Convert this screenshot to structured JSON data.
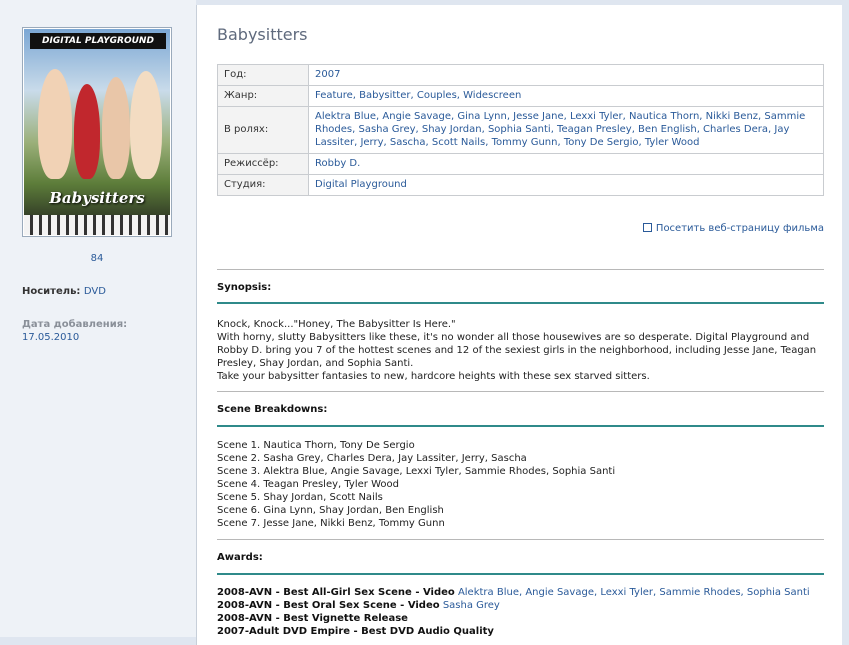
{
  "sidebar": {
    "cover_banner": "DIGITAL PLAYGROUND",
    "cover_title": "Babysitters",
    "cover_number": "84",
    "media_label": "Носитель:",
    "media_value": "DVD",
    "added_label": "Дата добавления:",
    "added_date": "17.05.2010"
  },
  "movie": {
    "title": "Babysitters",
    "info": [
      {
        "key": "Год:",
        "value": "2007"
      },
      {
        "key": "Жанр:",
        "value": "Feature, Babysitter, Couples, Widescreen"
      },
      {
        "key": "В ролях:",
        "value": "Alektra Blue, Angie Savage, Gina Lynn, Jesse Jane, Lexxi Tyler, Nautica Thorn, Nikki Benz, Sammie Rhodes, Sasha Grey, Shay Jordan, Sophia Santi, Teagan Presley, Ben English, Charles Dera, Jay Lassiter, Jerry, Sascha, Scott Nails, Tommy Gunn, Tony De Sergio, Tyler Wood"
      },
      {
        "key": "Режиссёр:",
        "value": "Robby D."
      },
      {
        "key": "Студия:",
        "value": "Digital Playground"
      }
    ],
    "web_link": "Посетить веб-страницу фильма"
  },
  "synopsis": {
    "heading": "Synopsis:",
    "text": "Knock, Knock...\"Honey, The Babysitter Is Here.\"\nWith horny, slutty Babysitters like these, it's no wonder all those housewives are so desperate. Digital Playground and Robby D. bring you 7 of the hottest scenes and 12 of the sexiest girls in the neighborhood, including Jesse Jane, Teagan Presley, Shay Jordan, and Sophia Santi.\nTake your babysitter fantasies to new, hardcore heights with these sex starved sitters."
  },
  "scenes": {
    "heading": "Scene Breakdowns:",
    "text": "Scene 1. Nautica Thorn, Tony De Sergio\nScene 2. Sasha Grey, Charles Dera, Jay Lassiter, Jerry, Sascha\nScene 3. Alektra Blue, Angie Savage, Lexxi Tyler, Sammie Rhodes, Sophia Santi\nScene 4. Teagan Presley, Tyler Wood\nScene 5. Shay Jordan, Scott Nails\nScene 6. Gina Lynn, Shay Jordan, Ben English\nScene 7. Jesse Jane, Nikki Benz, Tommy Gunn"
  },
  "awards": {
    "heading": "Awards:",
    "items": [
      {
        "title": "2008-AVN - Best All-Girl Sex Scene - Video",
        "names": "Alektra Blue, Angie Savage, Lexxi Tyler, Sammie Rhodes, Sophia Santi"
      },
      {
        "title": "2008-AVN - Best Oral Sex Scene - Video",
        "names": "Sasha Grey"
      },
      {
        "title": "2008-AVN - Best Vignette Release",
        "names": ""
      },
      {
        "title": "2007-Adult DVD Empire - Best DVD Audio Quality",
        "names": ""
      }
    ]
  },
  "colors": {
    "accent_line": "#2f8a8a",
    "link": "#2a5a99",
    "title": "#5f6a7d"
  }
}
